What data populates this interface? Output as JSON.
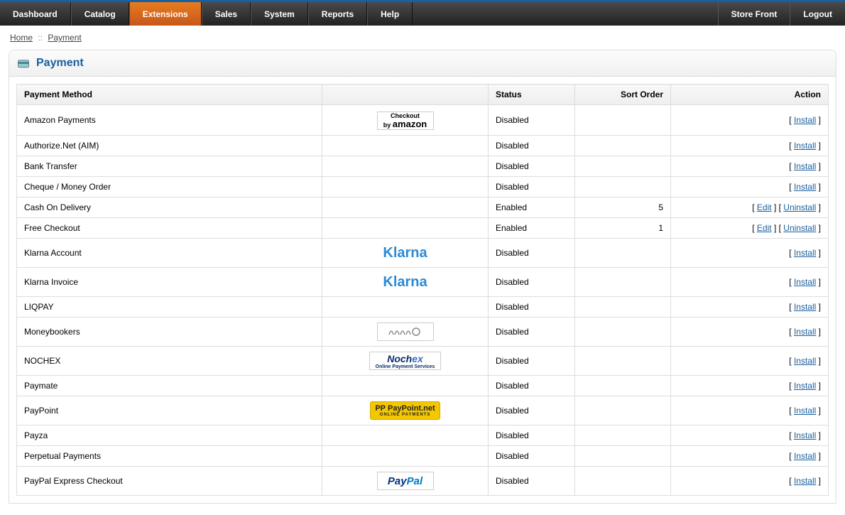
{
  "nav": {
    "left": [
      "Dashboard",
      "Catalog",
      "Extensions",
      "Sales",
      "System",
      "Reports",
      "Help"
    ],
    "active": "Extensions",
    "right": [
      "Store Front",
      "Logout"
    ]
  },
  "breadcrumb": {
    "home": "Home",
    "sep": "::",
    "current": "Payment"
  },
  "page_title": "Payment",
  "table": {
    "headers": {
      "method": "Payment Method",
      "logo": "",
      "status": "Status",
      "sort_order": "Sort Order",
      "action": "Action"
    },
    "actions": {
      "install": "Install",
      "edit": "Edit",
      "uninstall": "Uninstall"
    },
    "rows": [
      {
        "name": "Amazon Payments",
        "logo": "amazon",
        "status": "Disabled",
        "sort_order": "",
        "actions": [
          "install"
        ]
      },
      {
        "name": "Authorize.Net (AIM)",
        "logo": "",
        "status": "Disabled",
        "sort_order": "",
        "actions": [
          "install"
        ]
      },
      {
        "name": "Bank Transfer",
        "logo": "",
        "status": "Disabled",
        "sort_order": "",
        "actions": [
          "install"
        ]
      },
      {
        "name": "Cheque / Money Order",
        "logo": "",
        "status": "Disabled",
        "sort_order": "",
        "actions": [
          "install"
        ]
      },
      {
        "name": "Cash On Delivery",
        "logo": "",
        "status": "Enabled",
        "sort_order": "5",
        "actions": [
          "edit",
          "uninstall"
        ]
      },
      {
        "name": "Free Checkout",
        "logo": "",
        "status": "Enabled",
        "sort_order": "1",
        "actions": [
          "edit",
          "uninstall"
        ]
      },
      {
        "name": "Klarna Account",
        "logo": "klarna",
        "status": "Disabled",
        "sort_order": "",
        "actions": [
          "install"
        ]
      },
      {
        "name": "Klarna Invoice",
        "logo": "klarna",
        "status": "Disabled",
        "sort_order": "",
        "actions": [
          "install"
        ]
      },
      {
        "name": "LIQPAY",
        "logo": "",
        "status": "Disabled",
        "sort_order": "",
        "actions": [
          "install"
        ]
      },
      {
        "name": "Moneybookers",
        "logo": "moneybookers",
        "status": "Disabled",
        "sort_order": "",
        "actions": [
          "install"
        ]
      },
      {
        "name": "NOCHEX",
        "logo": "nochex",
        "status": "Disabled",
        "sort_order": "",
        "actions": [
          "install"
        ]
      },
      {
        "name": "Paymate",
        "logo": "",
        "status": "Disabled",
        "sort_order": "",
        "actions": [
          "install"
        ]
      },
      {
        "name": "PayPoint",
        "logo": "paypoint",
        "status": "Disabled",
        "sort_order": "",
        "actions": [
          "install"
        ]
      },
      {
        "name": "Payza",
        "logo": "",
        "status": "Disabled",
        "sort_order": "",
        "actions": [
          "install"
        ]
      },
      {
        "name": "Perpetual Payments",
        "logo": "",
        "status": "Disabled",
        "sort_order": "",
        "actions": [
          "install"
        ]
      },
      {
        "name": "PayPal Express Checkout",
        "logo": "paypal",
        "status": "Disabled",
        "sort_order": "",
        "actions": [
          "install"
        ]
      }
    ]
  }
}
